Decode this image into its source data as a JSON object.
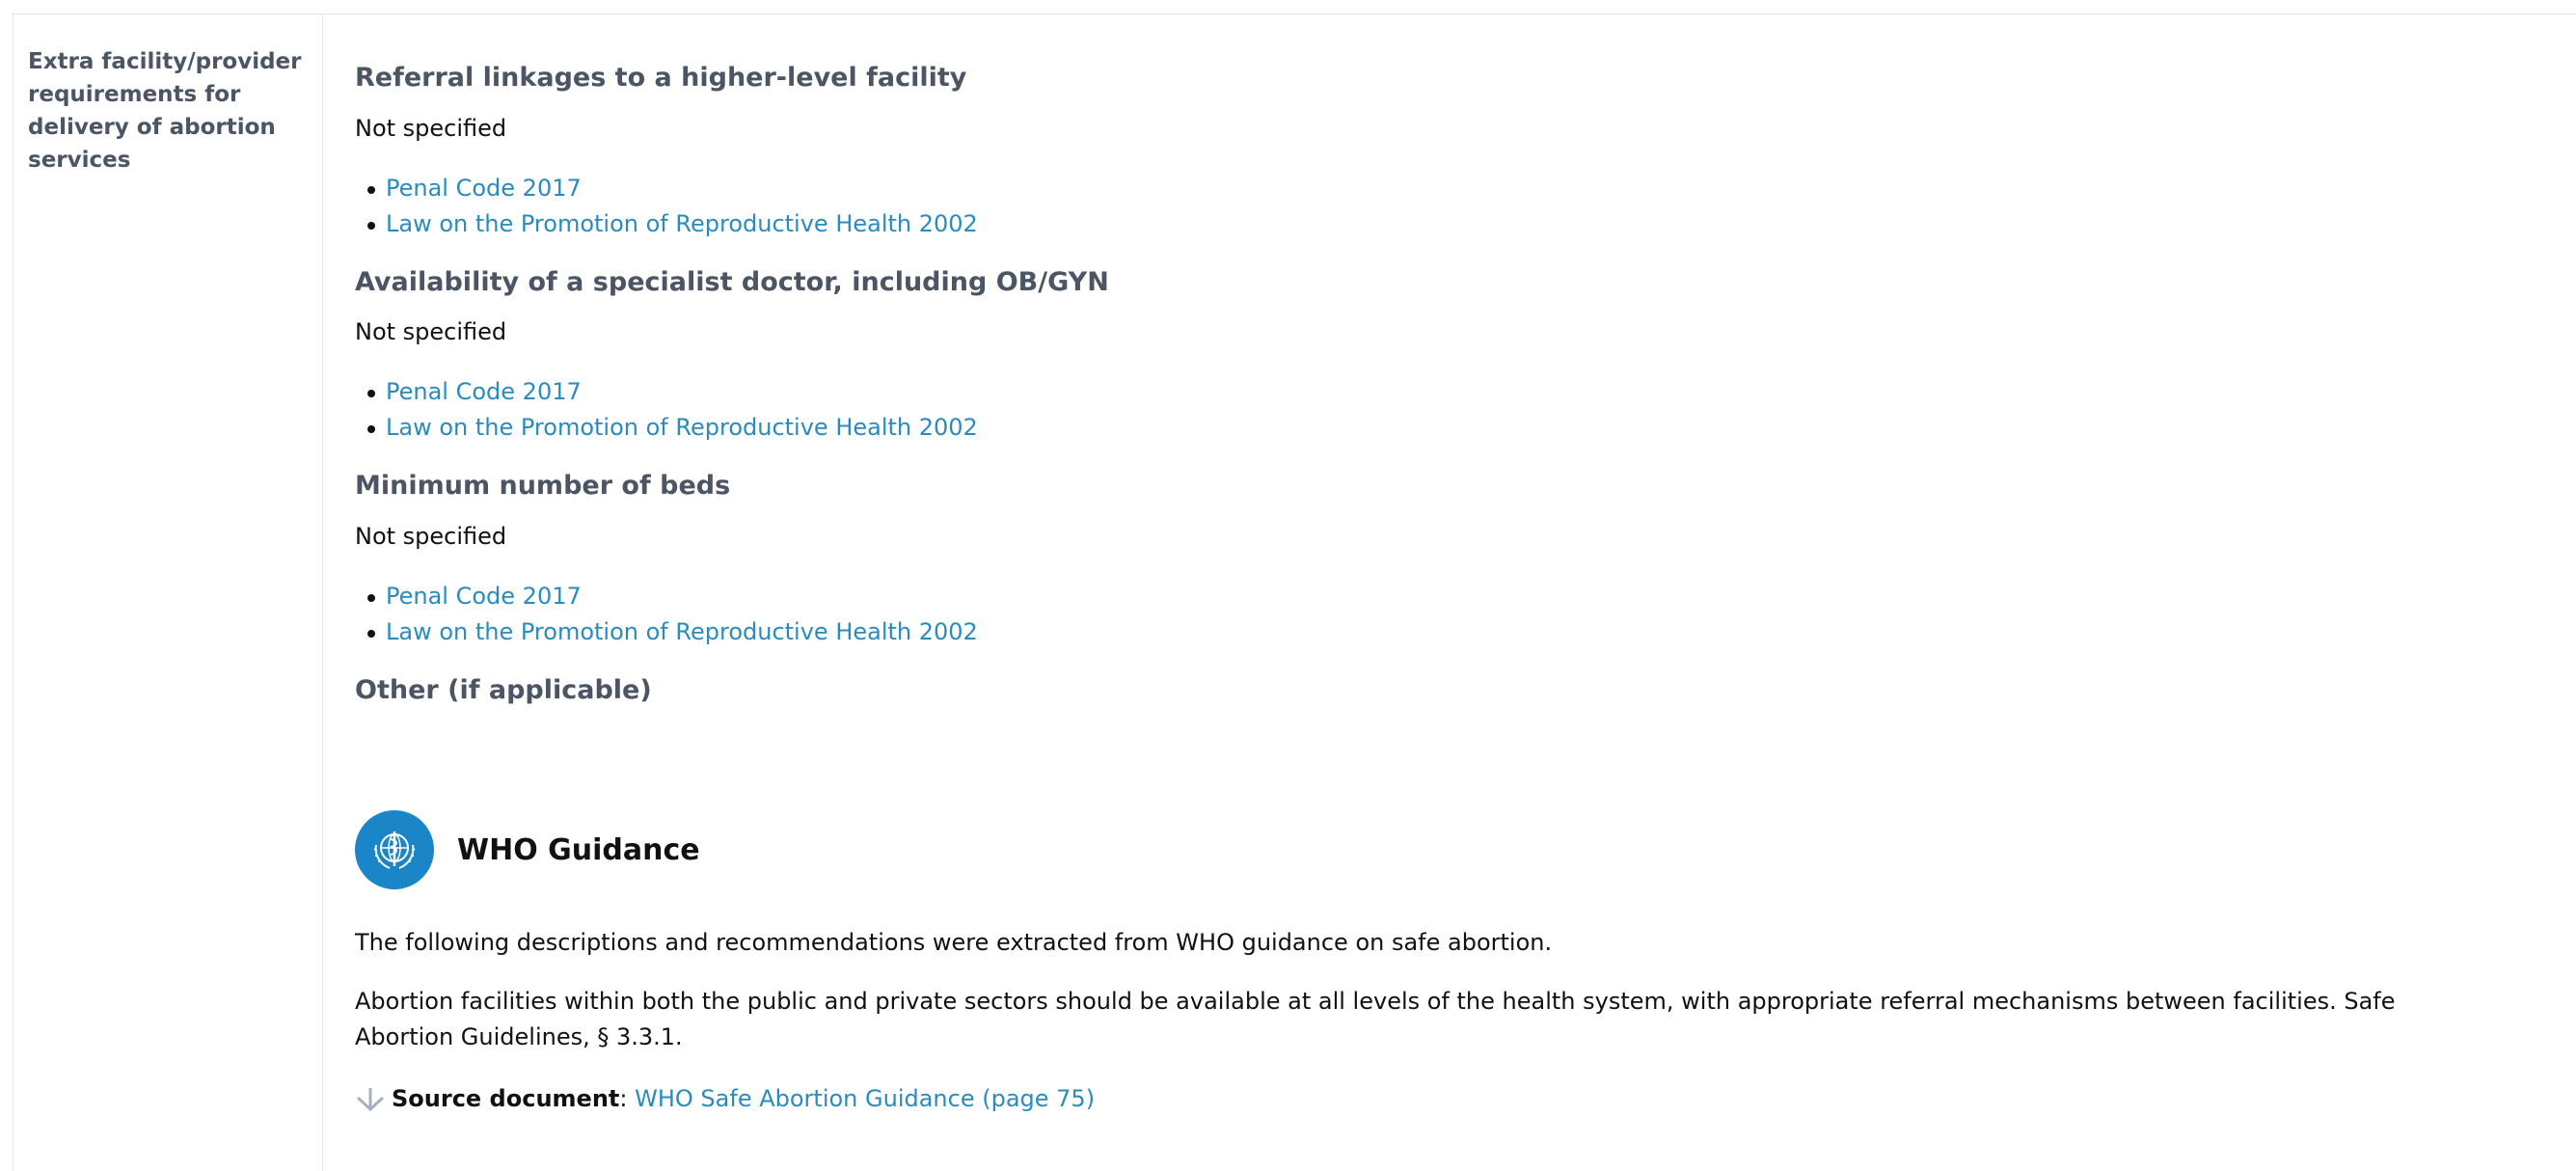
{
  "row": {
    "label": "Extra facility/provider requirements for delivery of abortion services"
  },
  "sections": [
    {
      "heading": "Referral linkages to a higher-level facility",
      "value": "Not specified",
      "refs": [
        "Penal Code 2017",
        "Law on the Promotion of Reproductive Health 2002"
      ]
    },
    {
      "heading": "Availability of a specialist doctor, including OB/GYN",
      "value": "Not specified",
      "refs": [
        "Penal Code 2017",
        "Law on the Promotion of Reproductive Health 2002"
      ]
    },
    {
      "heading": "Minimum number of beds",
      "value": "Not specified",
      "refs": [
        "Penal Code 2017",
        "Law on the Promotion of Reproductive Health 2002"
      ]
    },
    {
      "heading": "Other (if applicable)"
    }
  ],
  "who": {
    "title": "WHO Guidance",
    "intro": "The following descriptions and recommendations were extracted from WHO guidance on safe abortion.",
    "body": "Abortion facilities within both the public and private sectors should be available at all levels of the health system, with appropriate referral mechanisms between facilities. Safe Abortion Guidelines, § 3.3.1.",
    "source_label": "Source document",
    "source_sep": ":",
    "source_link": "WHO Safe Abortion Guidance (page 75)",
    "logo_color": "#1a86c8"
  },
  "colors": {
    "link": "#2a8bbf",
    "heading": "#4b5563",
    "border": "#e3e5e8"
  }
}
